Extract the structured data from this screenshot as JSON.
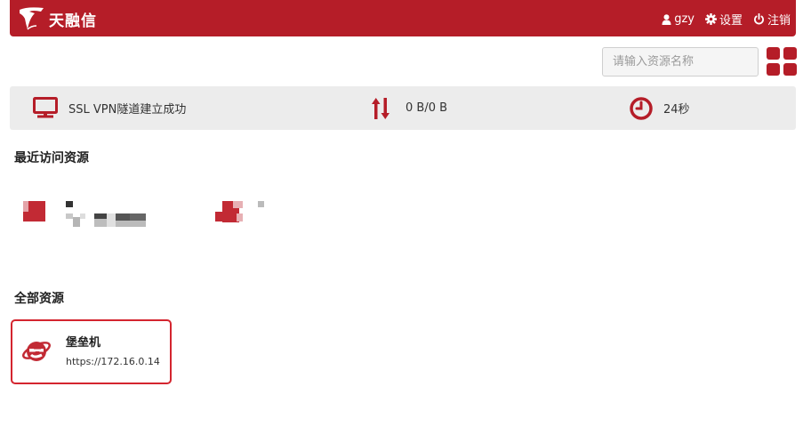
{
  "header": {
    "logo_text": "天融信",
    "user": "gzy",
    "settings_label": "设置",
    "logout_label": "注销"
  },
  "search": {
    "placeholder": "请输入资源名称"
  },
  "status": {
    "tunnel_text": "SSL VPN隧道建立成功",
    "traffic_text": "0 B/0 B",
    "duration_text": "24秒"
  },
  "recent": {
    "title": "最近访问资源"
  },
  "all_resources": {
    "title": "全部资源",
    "items": [
      {
        "name": "堡垒机",
        "url": "https://172.16.0.14",
        "icon": "ie-browser-icon"
      }
    ]
  },
  "colors": {
    "brand": "#b51d28",
    "card_border": "#d4252f",
    "status_bg": "#ececec"
  }
}
